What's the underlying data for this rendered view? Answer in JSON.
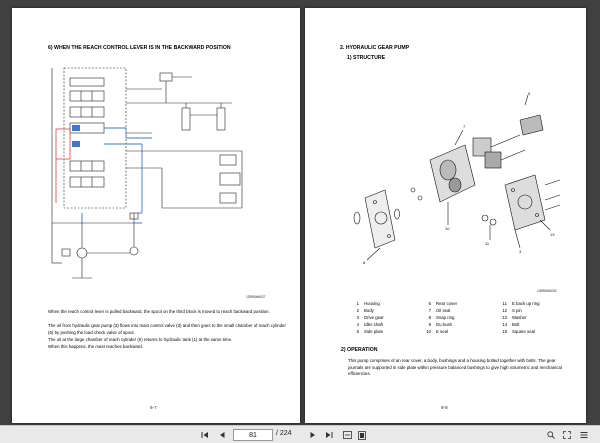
{
  "viewer": {
    "left_page": {
      "title": "6) WHEN THE REACH CONTROL LEVER IS IN THE BACKWARD POSITION",
      "figure_code": "12BR6HA027",
      "paragraphs": [
        "When the reach control lever is pulled backward, the spool on the third block is moved to reach backward position.",
        "The oil from hydraulic gear pump (2) flows into main control valve (3) and then goes to the small chamber of reach cylinder (6) by pushing the load check valve of spool.",
        "The oil at the large chamber of reach cylinder (6) returns to hydraulic tank (1) at the same time.",
        "When this happens, the mast reaches backward."
      ],
      "page_number": "6-7"
    },
    "right_page": {
      "section_title": "2. HYDRAULIC GEAR PUMP",
      "subsection_title": "1) STRUCTURE",
      "figure_code": "12BR6HA030",
      "parts": [
        {
          "n": "1",
          "name": "Housing"
        },
        {
          "n": "2",
          "name": "Body"
        },
        {
          "n": "3",
          "name": "Drive gear"
        },
        {
          "n": "4",
          "name": "Idler shaft"
        },
        {
          "n": "5",
          "name": "Side plate"
        },
        {
          "n": "6",
          "name": "Rear cover"
        },
        {
          "n": "7",
          "name": "Oil seal"
        },
        {
          "n": "8",
          "name": "Snap ring"
        },
        {
          "n": "9",
          "name": "Du bush"
        },
        {
          "n": "10",
          "name": "E seal"
        },
        {
          "n": "11",
          "name": "E back up ring"
        },
        {
          "n": "12",
          "name": "S pin"
        },
        {
          "n": "13",
          "name": "Washer"
        },
        {
          "n": "14",
          "name": "Bolt"
        },
        {
          "n": "15",
          "name": "Square seal"
        }
      ],
      "operation_title": "2) OPERATION",
      "operation_text": "This pump comprises of an rear cover, a body, bushings and a housing bolted together with bolts. The gear journals are supported in side plate within pressure balanced bushings to give high volumetric and mechanical efficiencies.",
      "page_number": "6-8"
    }
  },
  "toolbar": {
    "current_page": "81",
    "total": "/ 224",
    "icons": [
      "first-page-icon",
      "prev-page-icon",
      "next-page-icon",
      "last-page-icon",
      "fit-width-icon",
      "fit-page-icon",
      "zoom-icon",
      "fullscreen-icon",
      "menu-icon"
    ]
  },
  "colors": {
    "circuit_highlight": "#e23c3c",
    "circuit_active": "#3a78d4",
    "toolbar_bg": "#e9e9e9",
    "viewer_bg": "#404040"
  }
}
